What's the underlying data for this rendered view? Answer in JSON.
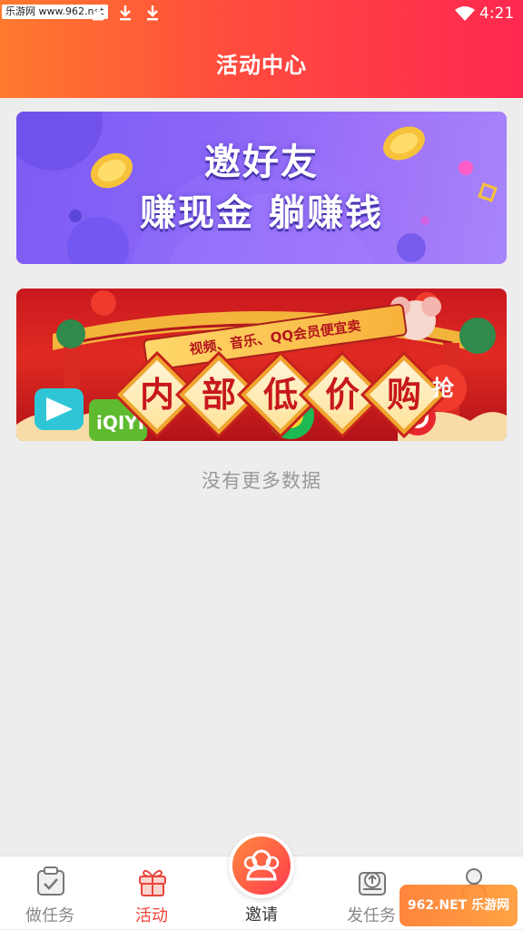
{
  "status_bar": {
    "watermark": "乐游网 www.962.net",
    "time": "4:21"
  },
  "header": {
    "title": "活动中心",
    "background_gradient": [
      "#ff7a2e",
      "#ff2850"
    ]
  },
  "banners": [
    {
      "name": "invite-banner",
      "title": "邀好友",
      "subtitle": "赚现金 躺赚钱"
    },
    {
      "name": "shop-banner",
      "topline": "视频、音乐、QQ会员便宜卖",
      "chars": [
        "内",
        "部",
        "低",
        "价",
        "购"
      ],
      "tag": "抢"
    }
  ],
  "footer_text": "没有更多数据",
  "bottom_nav": {
    "items": [
      {
        "label": "做任务",
        "icon": "task-icon",
        "active": false
      },
      {
        "label": "活动",
        "icon": "gift-icon",
        "active": true
      },
      {
        "label": "发任务",
        "icon": "upload-icon",
        "active": false
      }
    ],
    "center": {
      "label": "邀请",
      "icon": "users-icon"
    },
    "active_color": "#f0453a",
    "inactive_color": "#888888"
  },
  "corner_watermark": "962.NET 乐游网"
}
